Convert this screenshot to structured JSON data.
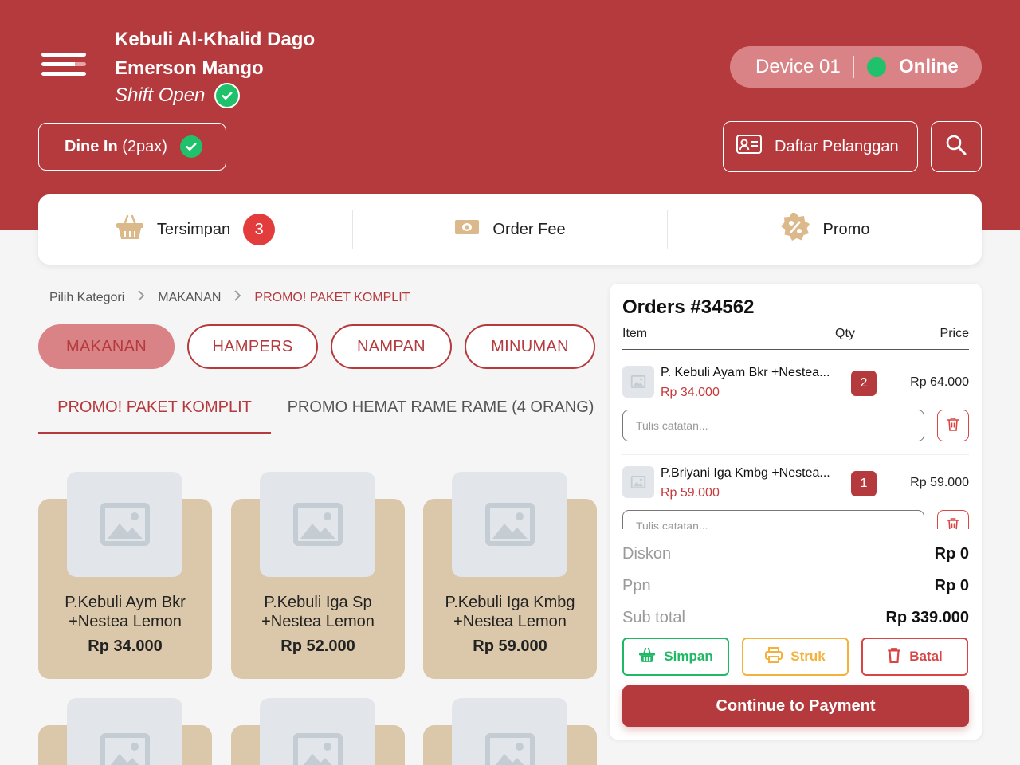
{
  "header": {
    "store_name": "Kebuli Al-Khalid Dago",
    "cashier_name": "Emerson Mango",
    "shift_status": "Shift Open",
    "device_label": "Device 01",
    "connection_status": "Online",
    "dine_in_label": "Dine In",
    "dine_in_pax": " (2pax)",
    "customer_list_label": "Daftar Pelanggan"
  },
  "action_bar": {
    "saved_label": "Tersimpan",
    "saved_count": "3",
    "order_fee_label": "Order Fee",
    "promo_label": "Promo"
  },
  "breadcrumb": [
    "Pilih Kategori",
    "MAKANAN",
    "PROMO! PAKET KOMPLIT"
  ],
  "categories": [
    "MAKANAN",
    "HAMPERS",
    "NAMPAN",
    "MINUMAN"
  ],
  "selected_category": "MAKANAN",
  "subtabs": [
    "PROMO! PAKET KOMPLIT",
    "PROMO HEMAT RAME RAME (4 ORANG)"
  ],
  "active_subtab": "PROMO! PAKET KOMPLIT",
  "products": [
    {
      "name_line1": "P.Kebuli Aym Bkr",
      "name_line2": "+Nestea Lemon",
      "price": "Rp 34.000"
    },
    {
      "name_line1": "P.Kebuli Iga Sp",
      "name_line2": "+Nestea Lemon",
      "price": "Rp 52.000"
    },
    {
      "name_line1": "P.Kebuli Iga Kmbg",
      "name_line2": "+Nestea Lemon",
      "price": "Rp 59.000"
    }
  ],
  "order": {
    "title": "Orders #34562",
    "col_item": "Item",
    "col_qty": "Qty",
    "col_price": "Price",
    "note_placeholder": "Tulis catatan...",
    "items": [
      {
        "name": "P. Kebuli Ayam Bkr +Nestea...",
        "unit_price": "Rp 34.000",
        "qty": "2",
        "total": "Rp 64.000"
      },
      {
        "name": "P.Briyani Iga Kmbg +Nestea...",
        "unit_price": "Rp 59.000",
        "qty": "1",
        "total": "Rp 59.000"
      }
    ],
    "discount_label": "Diskon",
    "discount_value": "Rp 0",
    "tax_label": "Ppn",
    "tax_value": "Rp 0",
    "subtotal_label": "Sub total",
    "subtotal_value": "Rp 339.000",
    "save_label": "Simpan",
    "receipt_label": "Struk",
    "cancel_label": "Batal",
    "pay_label": "Continue to Payment"
  },
  "colors": {
    "brand": "#b53a3d",
    "accent_light": "#d98386",
    "success": "#1fc16b",
    "warning": "#f4b23c",
    "danger": "#d94545",
    "card": "#dbc7aa"
  }
}
